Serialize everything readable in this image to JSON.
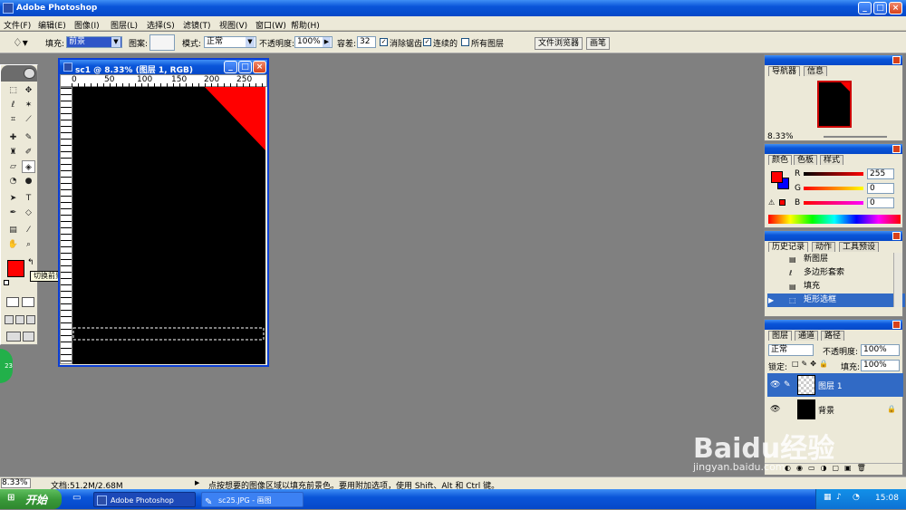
{
  "title_bar": {
    "title": "Adobe Photoshop",
    "min": "_",
    "max": "□",
    "close": "×"
  },
  "menu": [
    "文件(F)",
    "编辑(E)",
    "图像(I)",
    "图层(L)",
    "选择(S)",
    "滤镜(T)",
    "视图(V)",
    "窗口(W)",
    "帮助(H)"
  ],
  "options": {
    "fill_label": "填充:",
    "fill_value": "前景",
    "pattern_label": "图案:",
    "mode_label": "模式:",
    "mode_value": "正常",
    "opacity_label": "不透明度:",
    "opacity_value": "100%",
    "tolerance_label": "容差:",
    "tolerance_value": "32",
    "antialias_label": "消除锯齿",
    "contiguous_label": "连续的",
    "all_layers_label": "所有图层",
    "file_browser": "文件浏览器",
    "brushes": "画笔"
  },
  "tooltip": "切换前景和背景色 (X)",
  "foreground_color": "#ff0000",
  "background_color": "#0000ff",
  "document": {
    "title": "sc1 @ 8.33% (图层 1, RGB)",
    "ruler_marks": [
      "0",
      "50",
      "100",
      "150",
      "200",
      "250"
    ],
    "canvas_color": "#000000",
    "triangle_color": "#ff0000"
  },
  "navigator": {
    "tabs": [
      "导航器",
      "信息"
    ],
    "zoom": "8.33%"
  },
  "color_panel": {
    "tabs": [
      "颜色",
      "色板",
      "样式"
    ],
    "channels": [
      {
        "label": "R",
        "value": "255"
      },
      {
        "label": "G",
        "value": "0"
      },
      {
        "label": "B",
        "value": "0"
      }
    ]
  },
  "history": {
    "tabs": [
      "历史记录",
      "动作",
      "工具预设"
    ],
    "items": [
      "新图层",
      "多边形套索",
      "填充",
      "矩形选框"
    ],
    "active_index": 3
  },
  "layers": {
    "tabs": [
      "图层",
      "通道",
      "路径"
    ],
    "blend": "正常",
    "opacity_label": "不透明度:",
    "opacity": "100%",
    "lock_label": "锁定:",
    "fill_label": "填充:",
    "fill": "100%",
    "items": [
      {
        "name": "图层 1",
        "active": true
      },
      {
        "name": "背景",
        "active": false
      }
    ]
  },
  "status": {
    "zoom": "8.33%",
    "doc": "文档:51.2M/2.68M",
    "hint": "点按想要的图像区域以填充前景色。要用附加选项，使用 Shift、Alt 和 Ctrl 键。"
  },
  "taskbar": {
    "start": "开始",
    "tasks": [
      "Adobe Photoshop",
      "sc25.JPG - 画图"
    ],
    "clock": "15:08"
  },
  "watermark": {
    "text": "Baidu经验",
    "url": "jingyan.baidu.com"
  }
}
